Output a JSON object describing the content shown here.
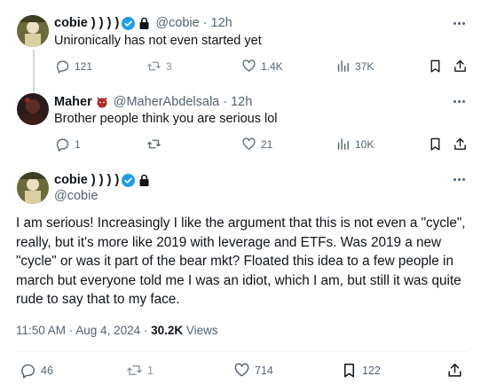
{
  "tweets": [
    {
      "name": "cobie ) ) ) )",
      "handle": "@cobie",
      "sep": "·",
      "time": "12h",
      "text": "Unironically has not even started yet",
      "replies": "121",
      "reposts": "3",
      "likes": "1.4K",
      "views": "37K"
    },
    {
      "name": "Maher",
      "handle": "@MaherAbdelsala",
      "sep": "·",
      "time": "12h",
      "text": "Brother people think you are serious lol",
      "replies": "1",
      "reposts": "",
      "likes": "21",
      "views": "10K"
    }
  ],
  "main": {
    "name": "cobie ) ) ) )",
    "handle": "@cobie",
    "text": "I am serious! Increasingly I like the argument that this is not even a \"cycle\", really, but it's more like 2019 with leverage and ETFs. Was 2019 a new \"cycle\" or was it part of the bear mkt? Floated this idea to a few people in march but everyone told me I was an idiot, which I am, but still it was quite rude to say that to my face.",
    "time": "11:50 AM · Aug 4, 2024 · ",
    "views_count": "30.2K",
    "views_label": " Views",
    "replies": "46",
    "reposts": "1",
    "likes": "714",
    "bookmarks": "122"
  },
  "colors": {
    "verified": "#1d9bf0",
    "muted": "#536471",
    "text": "#0f1419"
  }
}
